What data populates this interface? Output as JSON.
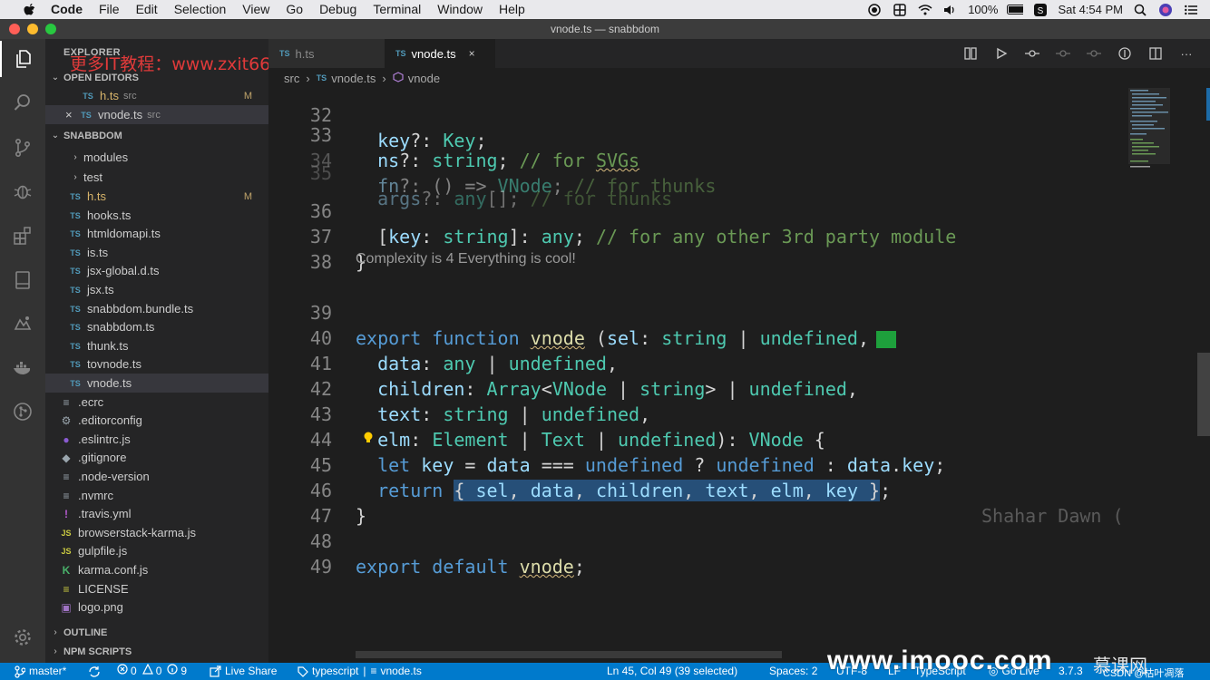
{
  "menubar": {
    "app": "Code",
    "items": [
      "File",
      "Edit",
      "Selection",
      "View",
      "Go",
      "Debug",
      "Terminal",
      "Window",
      "Help"
    ],
    "battery": "100%",
    "clock": "Sat 4:54 PM"
  },
  "window": {
    "title": "vnode.ts — snabbdom"
  },
  "watermarks": {
    "top": "更多IT教程：www.zxit666.com",
    "bottom": "www.imooc.com",
    "mooc": "慕课网",
    "csdn": "CSDN @枯叶凋落"
  },
  "sidebar": {
    "explorer_title": "EXPLORER",
    "open_editors_title": "OPEN EDITORS",
    "open_editors": [
      {
        "type": "TS",
        "name": "h.ts",
        "folder": "src",
        "status": "M"
      },
      {
        "type": "TS",
        "name": "vnode.ts",
        "folder": "src",
        "status": ""
      }
    ],
    "project_title": "SNABBDOM",
    "modules_folder": "modules",
    "test_folder": "test",
    "files": [
      {
        "type": "TS",
        "name": "h.ts",
        "status": "M"
      },
      {
        "type": "TS",
        "name": "hooks.ts",
        "status": ""
      },
      {
        "type": "TS",
        "name": "htmldomapi.ts",
        "status": ""
      },
      {
        "type": "TS",
        "name": "is.ts",
        "status": ""
      },
      {
        "type": "TS",
        "name": "jsx-global.d.ts",
        "status": ""
      },
      {
        "type": "TS",
        "name": "jsx.ts",
        "status": ""
      },
      {
        "type": "TS",
        "name": "snabbdom.bundle.ts",
        "status": ""
      },
      {
        "type": "TS",
        "name": "snabbdom.ts",
        "status": ""
      },
      {
        "type": "TS",
        "name": "thunk.ts",
        "status": ""
      },
      {
        "type": "TS",
        "name": "tovnode.ts",
        "status": ""
      },
      {
        "type": "TS",
        "name": "vnode.ts",
        "status": ""
      }
    ],
    "root_files": [
      {
        "icon": "≡",
        "name": ".ecrc"
      },
      {
        "icon": "⚙",
        "name": ".editorconfig"
      },
      {
        "icon": "●",
        "name": ".eslintrc.js"
      },
      {
        "icon": "◆",
        "name": ".gitignore"
      },
      {
        "icon": "≡",
        "name": ".node-version"
      },
      {
        "icon": "≡",
        "name": ".nvmrc"
      },
      {
        "icon": "!",
        "name": ".travis.yml"
      },
      {
        "icon": "JS",
        "name": "browserstack-karma.js"
      },
      {
        "icon": "JS",
        "name": "gulpfile.js"
      },
      {
        "icon": "K",
        "name": "karma.conf.js"
      },
      {
        "icon": "≡",
        "name": "LICENSE"
      },
      {
        "icon": "▣",
        "name": "logo.png"
      }
    ],
    "outline_title": "OUTLINE",
    "npm_title": "NPM SCRIPTS"
  },
  "tabs": [
    {
      "type": "TS",
      "name": "h.ts",
      "active": false
    },
    {
      "type": "TS",
      "name": "vnode.ts",
      "active": true,
      "close": "×"
    }
  ],
  "breadcrumb": {
    "folder": "src",
    "file": "vnode.ts",
    "symbol": "vnode"
  },
  "editor": {
    "codelens": "Complexity is 4 Everything is cool!",
    "ghost_text": "Shahar Dawn (",
    "lines": {
      "l32": "32",
      "l33": "33",
      "l34": "34",
      "l35": "35",
      "l36": "36",
      "l37": "37",
      "l38": "38",
      "l39": "39",
      "l40": "40",
      "l41": "41",
      "l42": "42",
      "l43": "43",
      "l44": "44",
      "l45": "45",
      "l46": "46",
      "l47": "47",
      "l48": "48",
      "l49": "49"
    }
  },
  "statusbar": {
    "branch": "master*",
    "errors": "0",
    "warnings": "0",
    "info": "9",
    "live_share": "Live Share",
    "language_scope": "typescript",
    "file": "vnode.ts",
    "position": "Ln 45, Col 49 (39 selected)",
    "spaces": "Spaces: 2",
    "encoding": "UTF-8",
    "eol": "LF",
    "language": "TypeScript",
    "go_live": "Go Live",
    "version": "3.7.3"
  },
  "colors": {
    "accent": "#007acc",
    "keyword": "#569cd6",
    "type": "#4ec9b0",
    "property": "#9cdcfe",
    "function": "#dcdcaa",
    "comment": "#6a9955",
    "selection": "#264f78"
  }
}
